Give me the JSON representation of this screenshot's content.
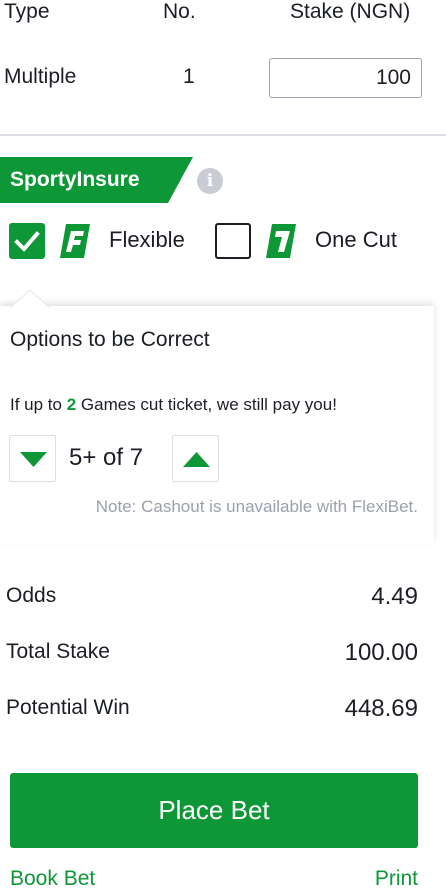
{
  "header": {
    "type_label": "Type",
    "no_label": "No.",
    "stake_label": "Stake (NGN)"
  },
  "bet_row": {
    "type": "Multiple",
    "count": "1",
    "stake_value": "100"
  },
  "insure": {
    "title": "SportyInsure",
    "info_icon": "info-icon",
    "options": [
      {
        "label": "Flexible",
        "checked": true,
        "logo_letter": "F"
      },
      {
        "label": "One Cut",
        "checked": false,
        "logo_letter": "1"
      }
    ]
  },
  "flexible_panel": {
    "title": "Options to be Correct",
    "subtitle_prefix": "If up to ",
    "subtitle_number": "2",
    "subtitle_suffix": " Games cut ticket, we still pay you!",
    "stepper_value": "5+ of 7",
    "note": "Note: Cashout is unavailable with FlexiBet."
  },
  "summary": {
    "odds_label": "Odds",
    "odds_value": "4.49",
    "total_stake_label": "Total Stake",
    "total_stake_value": "100.00",
    "potential_win_label": "Potential Win",
    "potential_win_value": "448.69"
  },
  "actions": {
    "place_bet": "Place Bet",
    "book_bet": "Book Bet",
    "print": "Print"
  },
  "colors": {
    "brand_green": "#0d9737",
    "text": "#1b1e25",
    "muted": "#9ca0ab"
  }
}
